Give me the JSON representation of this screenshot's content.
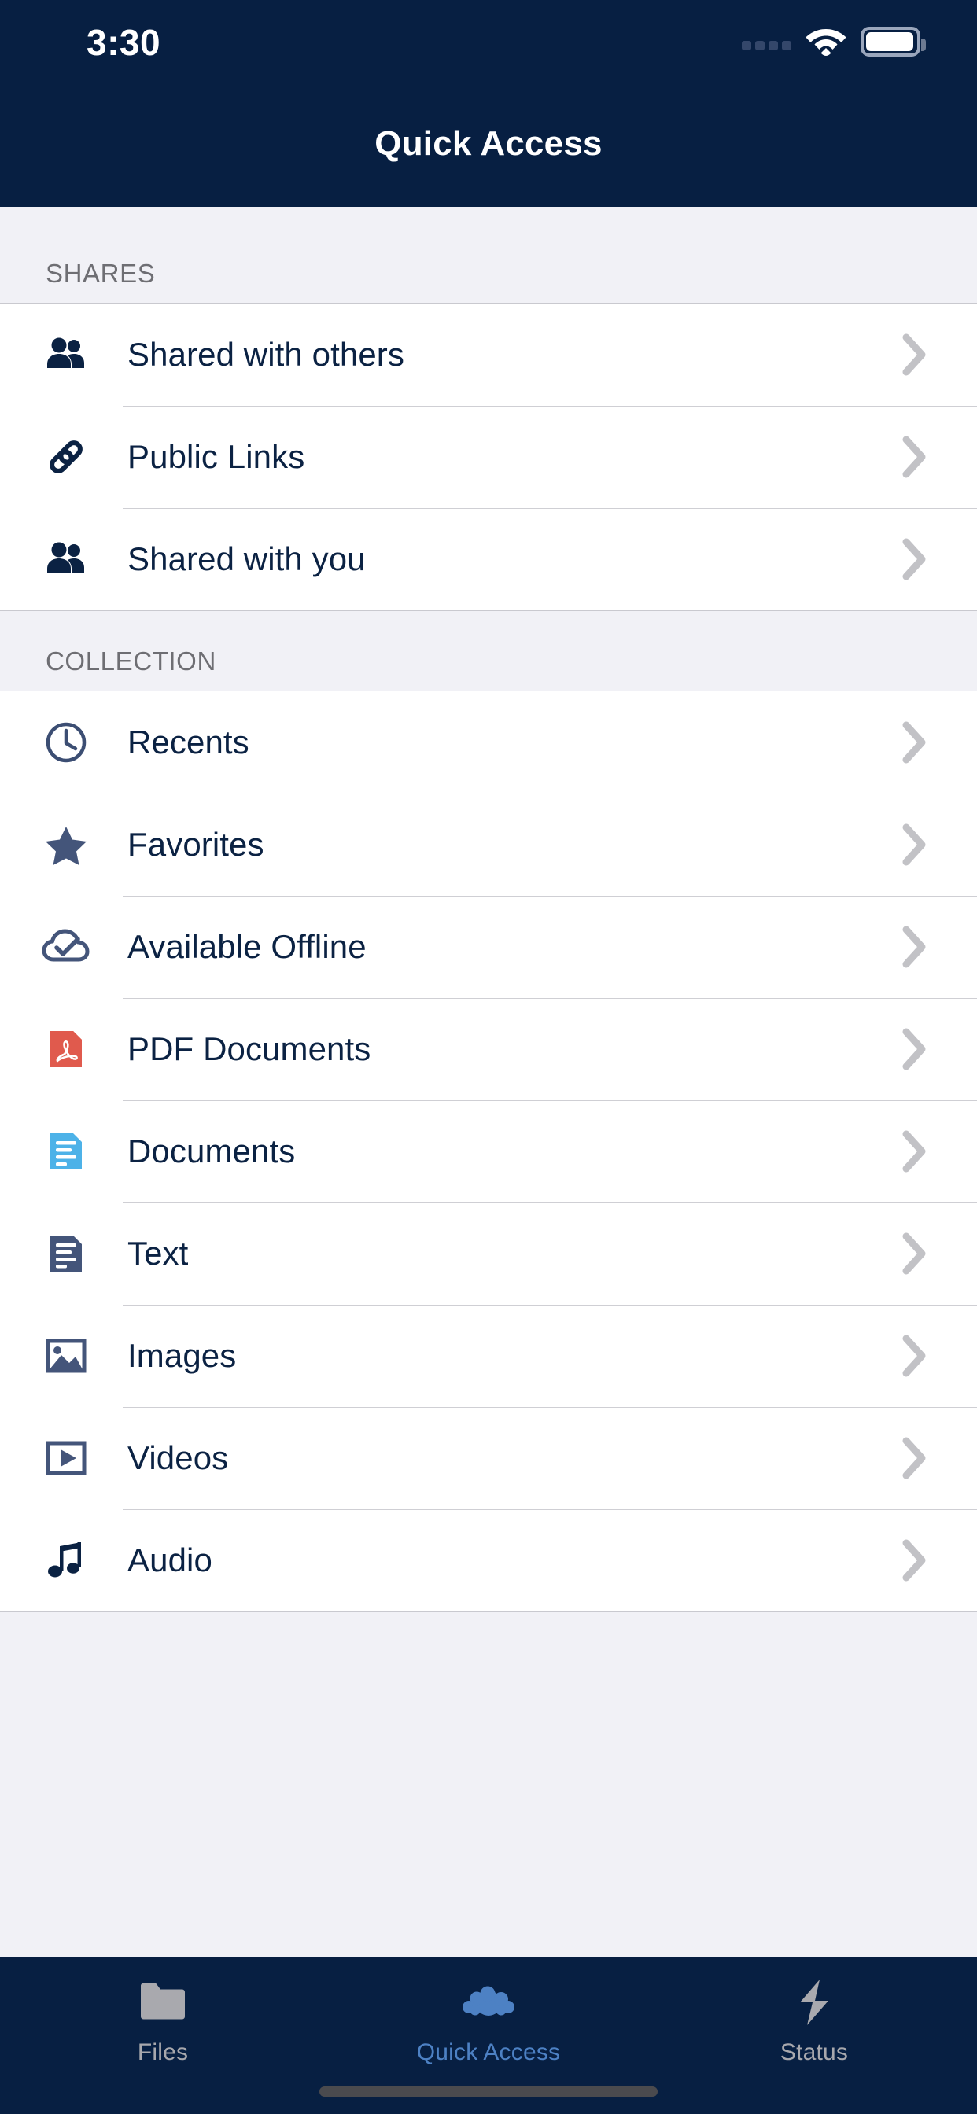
{
  "status_bar": {
    "time": "3:30",
    "signal_icon": "signal-dots-icon",
    "wifi_icon": "wifi-icon",
    "battery_icon": "battery-full-icon"
  },
  "nav": {
    "title": "Quick Access"
  },
  "sections": [
    {
      "header": "SHARES",
      "items": [
        {
          "label": "Shared with others",
          "icon": "people-icon",
          "accessory": "chevron-right-icon"
        },
        {
          "label": "Public Links",
          "icon": "link-icon",
          "accessory": "chevron-right-icon"
        },
        {
          "label": "Shared with you",
          "icon": "people-icon",
          "accessory": "chevron-right-icon"
        }
      ]
    },
    {
      "header": "COLLECTION",
      "items": [
        {
          "label": "Recents",
          "icon": "clock-icon",
          "accessory": "chevron-right-icon"
        },
        {
          "label": "Favorites",
          "icon": "star-icon",
          "accessory": "chevron-right-icon"
        },
        {
          "label": "Available Offline",
          "icon": "cloud-check-icon",
          "accessory": "chevron-right-icon"
        },
        {
          "label": "PDF Documents",
          "icon": "pdf-file-icon",
          "accessory": "chevron-right-icon"
        },
        {
          "label": "Documents",
          "icon": "document-file-icon",
          "accessory": "chevron-right-icon"
        },
        {
          "label": "Text",
          "icon": "text-file-icon",
          "accessory": "chevron-right-icon"
        },
        {
          "label": "Images",
          "icon": "image-icon",
          "accessory": "chevron-right-icon"
        },
        {
          "label": "Videos",
          "icon": "video-icon",
          "accessory": "chevron-right-icon"
        },
        {
          "label": "Audio",
          "icon": "audio-icon",
          "accessory": "chevron-right-icon"
        }
      ]
    }
  ],
  "tab_bar": {
    "tabs": [
      {
        "label": "Files",
        "icon": "folder-icon",
        "active": false
      },
      {
        "label": "Quick Access",
        "icon": "nextcloud-logo-icon",
        "active": true
      },
      {
        "label": "Status",
        "icon": "lightning-bolt-icon",
        "active": false
      }
    ]
  },
  "colors": {
    "nav_background": "#071f42",
    "content_background": "#f1f1f6",
    "row_background": "#ffffff",
    "label_text": "#0b2243",
    "section_header_text": "#6e6e73",
    "chevron": "#c2c2c6",
    "icon_dark": "#0b2243",
    "icon_slate": "#44557a",
    "pdf_red": "#e05a4d",
    "document_blue": "#4db2e8",
    "tab_active": "#4d81c4",
    "tab_inactive": "#a8a8ad",
    "nextcloud_blue": "#4d81c4"
  }
}
